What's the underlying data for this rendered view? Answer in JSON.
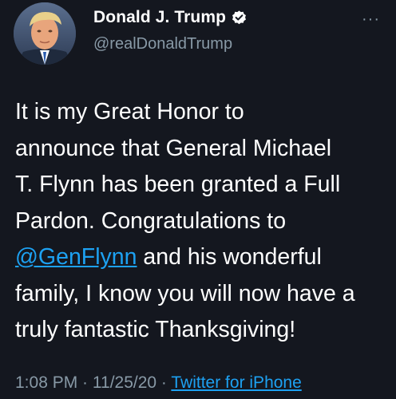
{
  "user": {
    "display_name": "Donald J. Trump",
    "handle": "@realDonaldTrump",
    "verified_icon": "verified-badge-icon",
    "avatar_icon": "profile-photo"
  },
  "menu": {
    "more_label": "···"
  },
  "tweet": {
    "line1": "It is my Great Honor to",
    "line2": "announce that General Michael",
    "line3": "T. Flynn has been granted a Full",
    "line4": "Pardon. Congratulations to",
    "mention": "@GenFlynn",
    "line5_rest": " and his wonderful",
    "line6": "family, I know you will now have a",
    "line7": "truly fantastic Thanksgiving!"
  },
  "meta": {
    "time": "1:08 PM",
    "separator1": " · ",
    "date": "11/25/20",
    "separator2": " · ",
    "source": "Twitter for iPhone"
  },
  "colors": {
    "background": "#14171f",
    "text": "#ffffff",
    "secondary": "#8899a6",
    "link": "#1da1f2"
  }
}
